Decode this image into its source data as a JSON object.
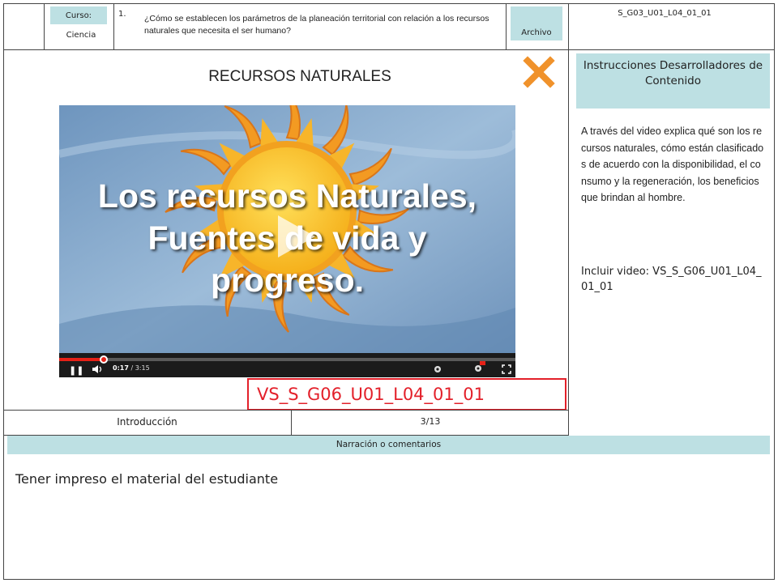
{
  "header": {
    "curso_label": "Curso:",
    "course_value": "Ciencia",
    "question_number": "1.",
    "question_text": "¿Cómo se establecen los parámetros de la planeación territorial con relación a los recursos naturales que necesita el ser humano?",
    "archivo_label": "Archivo",
    "file_code": "S_G03_U01_L04_01_01"
  },
  "slide": {
    "title": "RECURSOS NATURALES",
    "close_icon": "close-x-icon",
    "accent_color": "#f0922b"
  },
  "video": {
    "overlay_title_line1": "Los recursos Naturales,",
    "overlay_title_line2": "Fuentes de vida y",
    "overlay_title_line3": "progreso.",
    "time_current": "0:17",
    "time_total": "3:15",
    "progress": 0.097,
    "progress_color": "#e62117",
    "icons": [
      "pause-icon",
      "volume-icon",
      "settings-icon",
      "hd-badge-icon",
      "fullscreen-icon",
      "play-icon"
    ]
  },
  "video_code": "VS_S_G06_U01_L04_01_01",
  "footer": {
    "section": "Introducción",
    "page": "3/13"
  },
  "instructions": {
    "title": "Instrucciones Desarrolladores de Contenido",
    "body": "A través del video explica qué son los recursos naturales, cómo están clasificados de acuerdo con la disponibilidad, el consumo y la regeneración, los beneficios que brindan al hombre.",
    "include": "Incluir video: VS_S_G06_U01_L04_01_01"
  },
  "narration": {
    "label": "Narración o comentarios",
    "text": "Tener impreso el material del estudiante"
  },
  "colors": {
    "label_bg": "#bde0e3",
    "video_code_border": "#e3202a"
  }
}
